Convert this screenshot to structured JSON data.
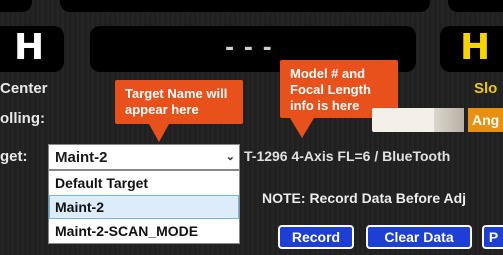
{
  "displays": {
    "left_value": "H",
    "center_value": "- - -",
    "right_value": "H"
  },
  "labels": {
    "center": "Center",
    "rolling": "olling:",
    "target": "get:",
    "slope": "Slo",
    "angle": "Ang"
  },
  "callouts": {
    "target_name": "Target Name will appear here",
    "model_info": "Model # and Focal Length info is here"
  },
  "target_select": {
    "value": "Maint-2",
    "options": [
      "Default Target",
      "Maint-2",
      "Maint-2-SCAN_MODE"
    ],
    "selected_index": 1
  },
  "device_info": "T-1296 4-Axis FL=6 / BlueTooth",
  "note": "NOTE: Record Data Before Adj",
  "buttons": {
    "record": "Record",
    "clear_data": "Clear Data",
    "partial": "P"
  },
  "colors": {
    "callout": "#e8511c",
    "button": "#1d3fd6",
    "slope_label": "#f0c800",
    "angle_box": "#e89010"
  }
}
